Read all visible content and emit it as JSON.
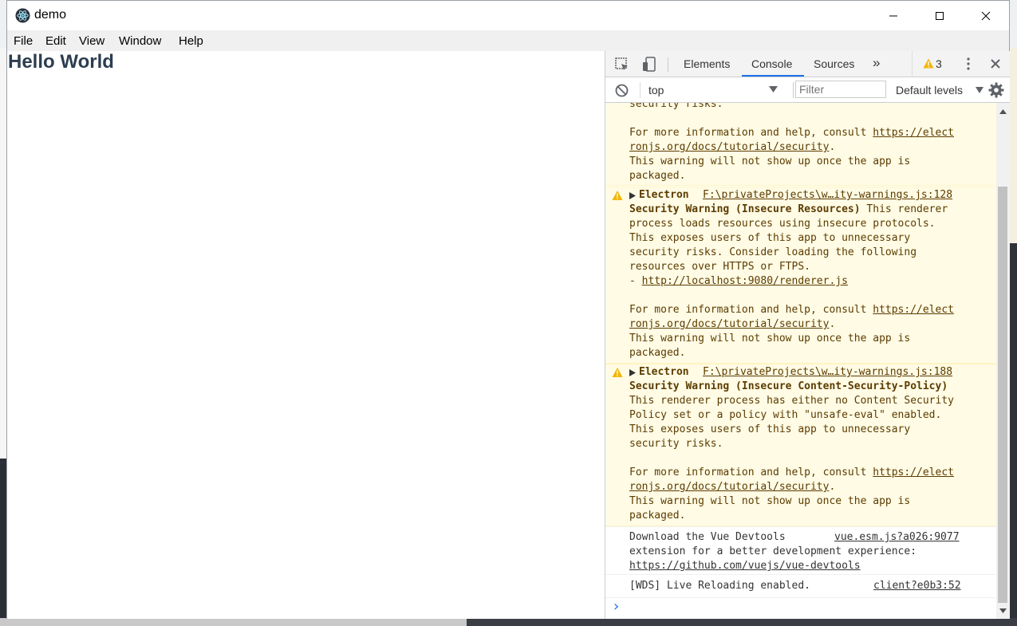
{
  "window": {
    "title": "demo",
    "controls": {
      "minimize": "minimize",
      "maximize": "maximize",
      "close": "close"
    }
  },
  "menu": {
    "items": [
      "File",
      "Edit",
      "View",
      "Window",
      "Help"
    ]
  },
  "app": {
    "heading": "Hello World"
  },
  "devtools": {
    "tabs": [
      "Elements",
      "Console",
      "Sources"
    ],
    "active_tab": "Console",
    "more_tabs_glyph": "»",
    "warning_count": "3",
    "context": "top",
    "filter_placeholder": "Filter",
    "levels": "Default levels",
    "messages": {
      "m1": {
        "l1": "security risks.",
        "l3": "For more information and help, consult ",
        "l3_link": "https://elect",
        "l4_link": "ronjs.org/docs/tutorial/security",
        "l4_end": ".",
        "l5": "This warning will not show up once the app is",
        "l6": "packaged."
      },
      "m2": {
        "tag": "Electron",
        "source": "F:\\privateProjects\\w…ity-warnings.js:128",
        "title": "Security Warning (Insecure Resources)",
        "l1_rest": " This renderer",
        "l2": "process loads resources using insecure protocols.",
        "l3": "This exposes users of this app to unnecessary",
        "l4": "security risks. Consider loading the following",
        "l5": "resources over HTTPS or FTPS.",
        "l6_prefix": "- ",
        "l6_link": "http://localhost:9080/renderer.js",
        "l8": "For more information and help, consult ",
        "l8_link": "https://elect",
        "l9_link": "ronjs.org/docs/tutorial/security",
        "l9_end": ".",
        "l10": "This warning will not show up once the app is",
        "l11": "packaged."
      },
      "m3": {
        "tag": "Electron",
        "source": "F:\\privateProjects\\w…ity-warnings.js:188",
        "title": "Security Warning (Insecure Content-Security-Policy)",
        "l2": "This renderer process has either no Content Security",
        "l3": "Policy set or a policy with \"unsafe-eval\" enabled.",
        "l4": "This exposes users of this app to unnecessary",
        "l5": "security risks.",
        "l7": "For more information and help, consult ",
        "l7_link": "https://elect",
        "l8_link": "ronjs.org/docs/tutorial/security",
        "l8_end": ".",
        "l9": "This warning will not show up once the app is",
        "l10": "packaged."
      },
      "m4": {
        "l1": "Download the Vue Devtools",
        "source": "vue.esm.js?a026:9077",
        "l2": "extension for a better development experience:",
        "l3_link": "https://github.com/vuejs/vue-devtools"
      },
      "m5": {
        "l1": "[WDS] Live Reloading enabled.",
        "source": "client?e0b3:52"
      }
    },
    "prompt_glyph": "›"
  },
  "colors": {
    "warning_bg": "#fffbe5",
    "warning_text": "#5c3c00",
    "warning_icon": "#f2b600",
    "accent": "#1a73e8",
    "heading": "#2c3e50"
  }
}
